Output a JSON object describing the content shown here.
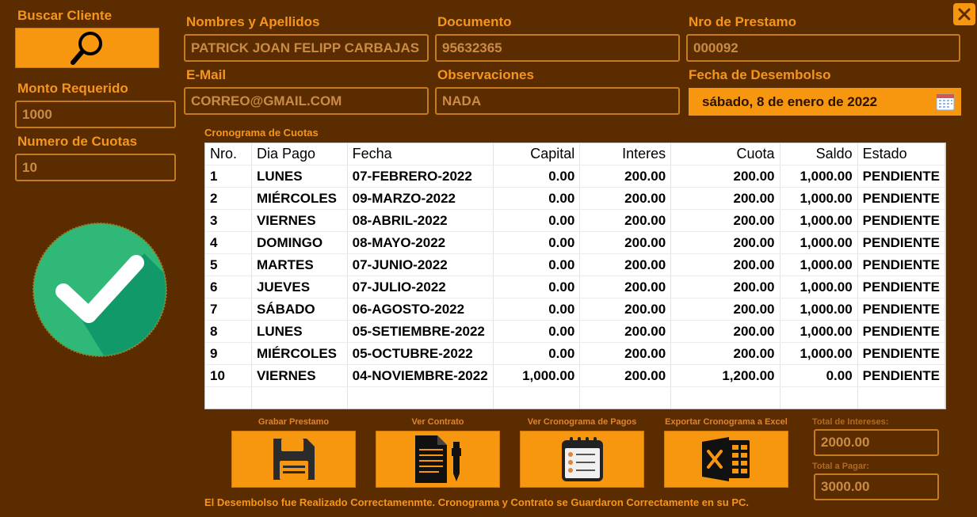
{
  "close_icon": "close-icon",
  "buscar_cliente": {
    "label": "Buscar Cliente",
    "icon": "search-icon"
  },
  "monto_requerido": {
    "label": "Monto Requerido",
    "value": "1000"
  },
  "numero_cuotas": {
    "label": "Numero de Cuotas",
    "value": "10"
  },
  "nombres": {
    "label": "Nombres y Apellidos",
    "value": "PATRICK JOAN FELIPP CARBAJAS"
  },
  "documento": {
    "label": "Documento",
    "value": "95632365"
  },
  "nro_prestamo": {
    "label": "Nro de Prestamo",
    "value": "000092"
  },
  "email": {
    "label": "E-Mail",
    "value": "CORREO@GMAIL.COM"
  },
  "observaciones": {
    "label": "Observaciones",
    "value": "NADA"
  },
  "fecha_desembolso": {
    "label": "Fecha de Desembolso",
    "value": "sábado, 8 de enero de 2022",
    "icon": "calendar-icon"
  },
  "success_icon": "check-circle-icon",
  "cronograma": {
    "title": "Cronograma de Cuotas",
    "columns": [
      "Nro.",
      "Dia Pago",
      "Fecha",
      "Capital",
      "Interes",
      "Cuota",
      "Saldo",
      "Estado"
    ],
    "rows": [
      [
        "1",
        "LUNES",
        "07-FEBRERO-2022",
        "0.00",
        "200.00",
        "200.00",
        "1,000.00",
        "PENDIENTE"
      ],
      [
        "2",
        "MIÉRCOLES",
        "09-MARZO-2022",
        "0.00",
        "200.00",
        "200.00",
        "1,000.00",
        "PENDIENTE"
      ],
      [
        "3",
        "VIERNES",
        "08-ABRIL-2022",
        "0.00",
        "200.00",
        "200.00",
        "1,000.00",
        "PENDIENTE"
      ],
      [
        "4",
        "DOMINGO",
        "08-MAYO-2022",
        "0.00",
        "200.00",
        "200.00",
        "1,000.00",
        "PENDIENTE"
      ],
      [
        "5",
        "MARTES",
        "07-JUNIO-2022",
        "0.00",
        "200.00",
        "200.00",
        "1,000.00",
        "PENDIENTE"
      ],
      [
        "6",
        "JUEVES",
        "07-JULIO-2022",
        "0.00",
        "200.00",
        "200.00",
        "1,000.00",
        "PENDIENTE"
      ],
      [
        "7",
        "SÁBADO",
        "06-AGOSTO-2022",
        "0.00",
        "200.00",
        "200.00",
        "1,000.00",
        "PENDIENTE"
      ],
      [
        "8",
        "LUNES",
        "05-SETIEMBRE-2022",
        "0.00",
        "200.00",
        "200.00",
        "1,000.00",
        "PENDIENTE"
      ],
      [
        "9",
        "MIÉRCOLES",
        "05-OCTUBRE-2022",
        "0.00",
        "200.00",
        "200.00",
        "1,000.00",
        "PENDIENTE"
      ],
      [
        "10",
        "VIERNES",
        "04-NOVIEMBRE-2022",
        "1,000.00",
        "200.00",
        "1,200.00",
        "0.00",
        "PENDIENTE"
      ]
    ]
  },
  "actions": {
    "grabar": {
      "label": "Grabar Prestamo",
      "icon": "floppy-disk-icon"
    },
    "contrato": {
      "label": "Ver Contrato",
      "icon": "document-pen-icon"
    },
    "cronograma": {
      "label": "Ver Cronograma de Pagos",
      "icon": "calendar-list-icon"
    },
    "excel": {
      "label": "Exportar Cronograma a Excel",
      "icon": "excel-icon"
    }
  },
  "totales": {
    "intereses_label": "Total de Intereses:",
    "intereses_value": "2000.00",
    "pagar_label": "Total a Pagar:",
    "pagar_value": "3000.00"
  },
  "status_message": "El Desembolso fue Realizado Correctamenmte. Cronograma y Contrato se Guardaron Correctamente en su PC."
}
